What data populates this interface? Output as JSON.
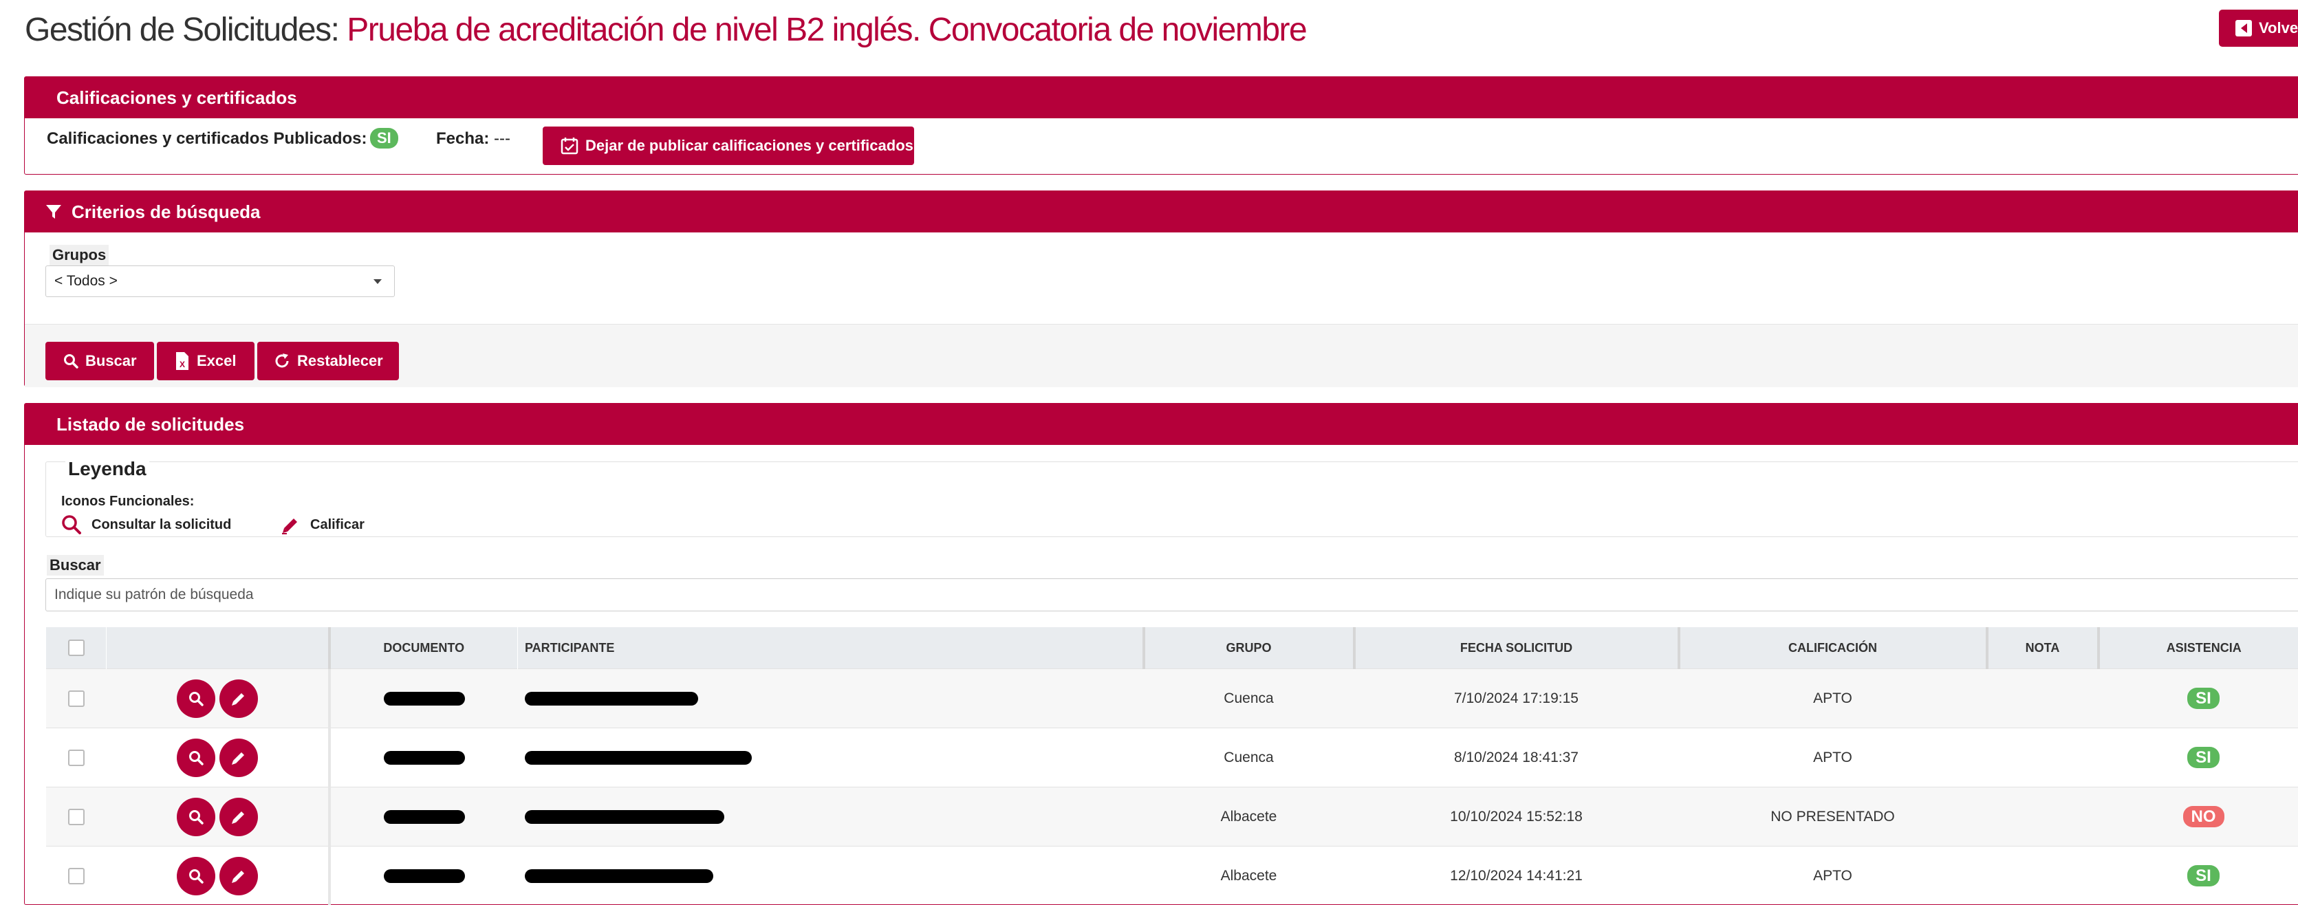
{
  "header": {
    "title_prefix": "Gestión de Solicitudes:",
    "title_name": "Prueba de acreditación de nivel B2 inglés. Convocatoria de noviembre",
    "back_label": "Volve"
  },
  "calificaciones": {
    "panel_title": "Calificaciones y certificados",
    "published_label": "Calificaciones y certificados Publicados:",
    "published_value": "SI",
    "fecha_label": "Fecha:",
    "fecha_value": "---",
    "unpublish_label": "Dejar de publicar calificaciones y certificados"
  },
  "criterios": {
    "panel_title": "Criterios de búsqueda",
    "grupos_label": "Grupos",
    "grupos_selected": "< Todos >",
    "buscar_label": "Buscar",
    "excel_label": "Excel",
    "reset_label": "Restablecer"
  },
  "listado": {
    "panel_title": "Listado de solicitudes",
    "legend_title": "Leyenda",
    "legend_subtitle": "Iconos Funcionales:",
    "legend_consultar": "Consultar la solicitud",
    "legend_calificar": "Calificar",
    "search_label": "Buscar",
    "search_placeholder": "Indique su patrón de búsqueda"
  },
  "table": {
    "columns": [
      "",
      "",
      "DOCUMENTO",
      "PARTICIPANTE",
      "GRUPO",
      "FECHA SOLICITUD",
      "CALIFICACIÓN",
      "NOTA",
      "ASISTENCIA"
    ],
    "rows": [
      {
        "grupo": "Cuenca",
        "fecha": "7/10/2024 17:19:15",
        "calificacion": "APTO",
        "nota": "",
        "asistencia": "SI"
      },
      {
        "grupo": "Cuenca",
        "fecha": "8/10/2024 18:41:37",
        "calificacion": "APTO",
        "nota": "",
        "asistencia": "SI"
      },
      {
        "grupo": "Albacete",
        "fecha": "10/10/2024 15:52:18",
        "calificacion": "NO PRESENTADO",
        "nota": "",
        "asistencia": "NO"
      },
      {
        "grupo": "Albacete",
        "fecha": "12/10/2024 14:41:21",
        "calificacion": "APTO",
        "nota": "",
        "asistencia": "SI"
      }
    ]
  },
  "colors": {
    "brand": "#b5003a",
    "success": "#5cb85c",
    "danger": "#ef6a6a"
  }
}
